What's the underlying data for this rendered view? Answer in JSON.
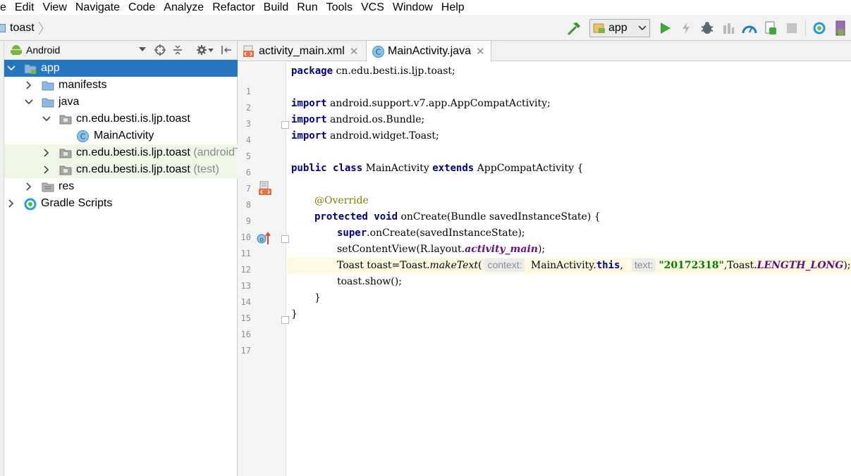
{
  "menu": {
    "items": [
      "e",
      "Edit",
      "View",
      "Navigate",
      "Code",
      "Analyze",
      "Refactor",
      "Build",
      "Run",
      "Tools",
      "VCS",
      "Window",
      "Help"
    ]
  },
  "breadcrumb": {
    "project": "toast"
  },
  "toolbar": {
    "run_config": "app"
  },
  "project_panel": {
    "view_mode": "Android",
    "tree": [
      {
        "label": "app",
        "suffix": "",
        "level": 0,
        "expanded": true,
        "icon": "module-folder-icon",
        "selected": true
      },
      {
        "label": "manifests",
        "suffix": "",
        "level": 1,
        "expanded": false,
        "icon": "folder-icon"
      },
      {
        "label": "java",
        "suffix": "",
        "level": 1,
        "expanded": true,
        "icon": "folder-icon"
      },
      {
        "label": "cn.edu.besti.is.ljp.toast",
        "suffix": "",
        "level": 2,
        "expanded": true,
        "icon": "package-icon"
      },
      {
        "label": "MainActivity",
        "suffix": "",
        "level": 3,
        "icon": "class-icon"
      },
      {
        "label": "cn.edu.besti.is.ljp.toast",
        "suffix": " (androidTest)",
        "level": 2,
        "expanded": false,
        "icon": "package-icon",
        "test": true
      },
      {
        "label": "cn.edu.besti.is.ljp.toast",
        "suffix": " (test)",
        "level": 2,
        "expanded": false,
        "icon": "package-icon",
        "test": true
      },
      {
        "label": "res",
        "suffix": "",
        "level": 1,
        "expanded": false,
        "icon": "res-folder-icon"
      },
      {
        "label": "Gradle Scripts",
        "suffix": "",
        "level": 0,
        "expanded": false,
        "icon": "gradle-icon"
      }
    ]
  },
  "editor": {
    "tabs": [
      {
        "label": "activity_main.xml",
        "active": false,
        "icon": "xml-file-icon"
      },
      {
        "label": "MainActivity.java",
        "active": true,
        "icon": "class-icon"
      }
    ],
    "caret_line": 13,
    "line_numbers": [
      "1",
      "2",
      "3",
      "4",
      "5",
      "6",
      "7",
      "8",
      "9",
      "10",
      "11",
      "12",
      "13",
      "14",
      "15",
      "16",
      "17"
    ],
    "code": {
      "l1_kw": "package",
      "l1_rest": " cn.edu.besti.is.ljp.toast;",
      "l3_kw": "import",
      "l3_rest": " android.support.v7.app.AppCompatActivity;",
      "l4_kw": "import",
      "l4_rest": " android.os.Bundle;",
      "l5_kw": "import",
      "l5_rest": " android.widget.Toast;",
      "l7_kw1": "public class",
      "l7_name": " MainActivity ",
      "l7_kw2": "extends",
      "l7_rest": " AppCompatActivity {",
      "l9_ann": "@Override",
      "l10_kw": "protected void",
      "l10_rest": " onCreate(Bundle savedInstanceState) {",
      "l11_kw": "super",
      "l11_rest": ".onCreate(savedInstanceState);",
      "l12_pre": "setContentView(R.layout.",
      "l12_field": "activity_main",
      "l12_post": ");",
      "l13_pre": "Toast toast=Toast.",
      "l13_method": "makeText",
      "l13_open": "(",
      "l13_hint1": "context:",
      "l13_arg1": " MainActivity.",
      "l13_this": "this",
      "l13_comma": ",",
      "l13_hint2": "text:",
      "l13_str": "\"20172318\"",
      "l13_mid": ",Toast.",
      "l13_const": "LENGTH_LONG",
      "l13_end": ");",
      "l14": "toast.show();",
      "l15": "}",
      "l16": "}"
    }
  }
}
